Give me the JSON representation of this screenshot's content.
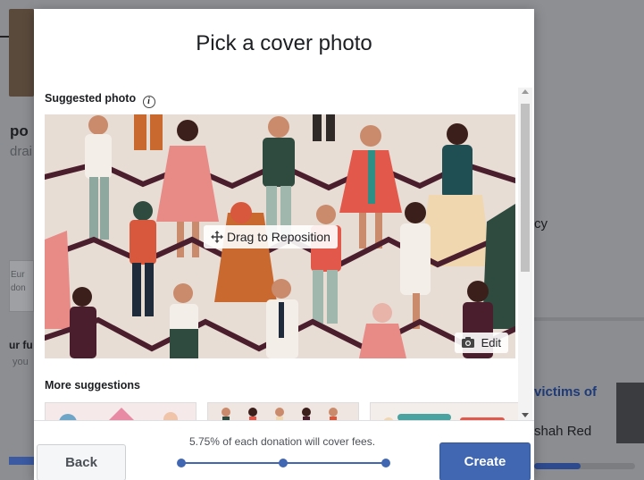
{
  "background": {
    "left_title": "po",
    "left_sub": "drai",
    "left_box_line1": "Eur",
    "left_box_line2": "don",
    "left_bold": "ur fu",
    "left_small": "you",
    "right_cy": "cy",
    "right_link": "victims of",
    "right_name": "shah Red"
  },
  "modal": {
    "title": "Pick a cover photo",
    "suggested_label": "Suggested photo",
    "info_glyph": "i",
    "drag_label": "Drag to Reposition",
    "edit_label": "Edit",
    "more_label": "More suggestions",
    "fee_text": "5.75% of each donation will cover fees.",
    "back_label": "Back",
    "create_label": "Create",
    "steps_total": 3,
    "current_step": 3
  },
  "colors": {
    "accent": "#4267b2",
    "cover_bg": "#e8ddd5"
  },
  "icons": [
    "info-icon",
    "move-icon",
    "camera-icon",
    "scroll-up-icon",
    "scroll-down-icon"
  ]
}
